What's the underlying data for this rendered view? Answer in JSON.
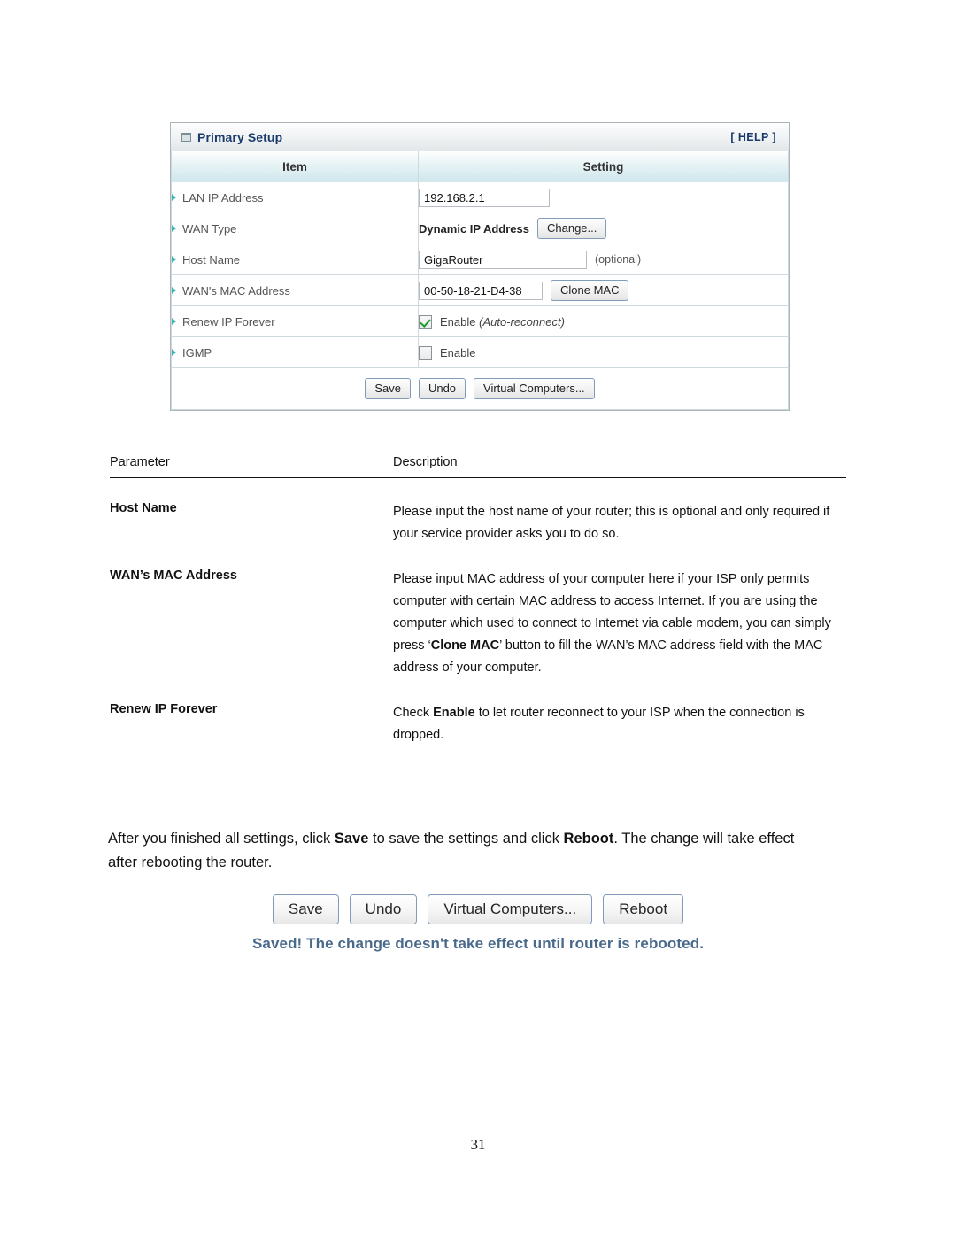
{
  "router_panel": {
    "title": "Primary Setup",
    "window_icon": "window-icon",
    "help_label": "[ HELP ]",
    "columns": {
      "item": "Item",
      "setting": "Setting"
    },
    "rows": [
      {
        "item": "LAN IP Address",
        "type": "text",
        "value": "192.168.2.1"
      },
      {
        "item": "WAN Type",
        "type": "static_with_button",
        "value": "Dynamic IP Address",
        "button": "Change..."
      },
      {
        "item": "Host Name",
        "type": "text_with_note",
        "value": "GigaRouter",
        "note": "(optional)"
      },
      {
        "item": "WAN's MAC Address",
        "type": "text_with_button",
        "value": "00-50-18-21-D4-38",
        "button": "Clone MAC"
      },
      {
        "item": "Renew IP Forever",
        "type": "checkbox",
        "checked": true,
        "label": "Enable",
        "label_italic": "(Auto-reconnect)"
      },
      {
        "item": "IGMP",
        "type": "checkbox",
        "checked": false,
        "label": "Enable",
        "label_italic": ""
      }
    ],
    "actions": {
      "save": "Save",
      "undo": "Undo",
      "virtual_computers": "Virtual Computers..."
    }
  },
  "doc_table": {
    "header": {
      "parameter": "Parameter",
      "description": "Description"
    },
    "rows": [
      {
        "parameter": "Host Name",
        "description_parts": [
          {
            "text": "Please input the host name of your router; this is optional and only required if your service provider asks you to do so.",
            "bold": false
          }
        ]
      },
      {
        "parameter": "WAN’s MAC Address",
        "description_parts": [
          {
            "text": "Please input MAC address of your computer here if your ISP only permits computer with certain MAC address to access Internet. If you are using the computer which used to connect to Internet via cable modem, you can simply press ‘",
            "bold": false
          },
          {
            "text": "Clone MAC",
            "bold": true
          },
          {
            "text": "’ button to fill the WAN’s MAC address field with the MAC address of your computer.",
            "bold": false
          }
        ]
      },
      {
        "parameter": "Renew IP Forever",
        "description_parts": [
          {
            "text": "Check ",
            "bold": false
          },
          {
            "text": "Enable",
            "bold": true
          },
          {
            "text": " to let router reconnect to your ISP when the connection is dropped.",
            "bold": false
          }
        ]
      }
    ]
  },
  "closing_paragraph": {
    "parts": [
      {
        "text": "After you finished all settings, click ",
        "bold": false
      },
      {
        "text": "Save",
        "bold": true
      },
      {
        "text": " to save the settings and click ",
        "bold": false
      },
      {
        "text": "Reboot",
        "bold": true
      },
      {
        "text": ". The change will take effect after rebooting the router.",
        "bold": false
      }
    ]
  },
  "bottom_strip": {
    "buttons": [
      "Save",
      "Undo",
      "Virtual Computers...",
      "Reboot"
    ],
    "saved_message": "Saved! The change doesn't take effect until router is rebooted."
  },
  "page_number": "31",
  "colors": {
    "panel_title": "#1a3a6b",
    "header_gradient_end": "#cfe7ec",
    "arrow_marker": "#3bb6b6",
    "checkbox_check": "#1a9b2e",
    "button_border": "#7f9db9",
    "saved_message": "#4a6a8c"
  }
}
